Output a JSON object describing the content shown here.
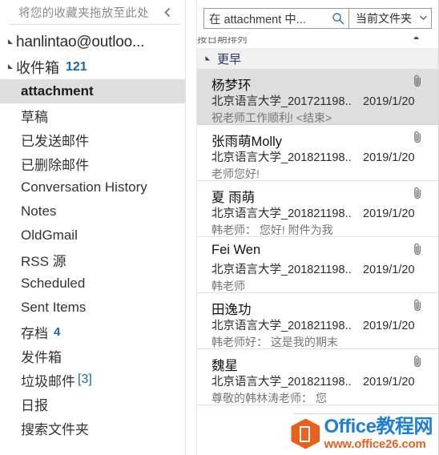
{
  "nav": {
    "favorites_hint": "将您的收藏夹拖放至此处",
    "collapse_icon": "chevron-left-icon",
    "account": {
      "label": "hanlintao@outloo...",
      "expander": "▲"
    },
    "inbox": {
      "label": "收件箱",
      "count": "121",
      "expander": "▲"
    },
    "items": [
      {
        "label": "attachment",
        "selected": true,
        "badge": ""
      },
      {
        "label": "草稿",
        "selected": false,
        "badge": ""
      },
      {
        "label": "已发送邮件",
        "selected": false,
        "badge": ""
      },
      {
        "label": "已删除邮件",
        "selected": false,
        "badge": ""
      },
      {
        "label": "Conversation History",
        "selected": false,
        "badge": ""
      },
      {
        "label": "Notes",
        "selected": false,
        "badge": ""
      },
      {
        "label": "OldGmail",
        "selected": false,
        "badge": ""
      },
      {
        "label": "RSS 源",
        "selected": false,
        "badge": ""
      },
      {
        "label": "Scheduled",
        "selected": false,
        "badge": ""
      },
      {
        "label": "Sent Items",
        "selected": false,
        "badge": ""
      },
      {
        "label": "存档",
        "selected": false,
        "badge": "4",
        "badge_style": "plain"
      },
      {
        "label": "发件箱",
        "selected": false,
        "badge": ""
      },
      {
        "label": "垃圾邮件",
        "selected": false,
        "badge": "[3]",
        "badge_style": "bracket"
      },
      {
        "label": "日报",
        "selected": false,
        "badge": ""
      },
      {
        "label": "搜索文件夹",
        "selected": false,
        "badge": ""
      }
    ]
  },
  "search": {
    "placeholder": "在 attachment 中...",
    "icon": "search-icon",
    "scope_label": "当前文件夹",
    "scope_caret": "▼"
  },
  "list_header": {
    "columns": "按日期排列",
    "sort_arrow": "▲"
  },
  "group": {
    "expander": "◢",
    "label": "更早"
  },
  "messages": [
    {
      "sender": "杨梦环",
      "subject": "北京语言大学_201721198...",
      "date": "2019/1/20",
      "preview": "祝老师工作顺利! <结束>",
      "attachment": "paperclip-icon",
      "selected": true
    },
    {
      "sender": "张雨萌Molly",
      "subject": "北京语言大学_201821198...",
      "date": "2019/1/20",
      "preview": "老师您好!",
      "attachment": "paperclip-icon",
      "selected": false
    },
    {
      "sender": "夏 雨萌",
      "subject": "北京语言大学_201821198...",
      "date": "2019/1/20",
      "preview": "韩老师：  您好!  附件为我",
      "attachment": "paperclip-icon",
      "selected": false
    },
    {
      "sender": "Fei Wen",
      "subject": "北京语言大学_201821198...",
      "date": "2019/1/20",
      "preview": "韩老师",
      "attachment": "paperclip-icon",
      "selected": false
    },
    {
      "sender": "田逸功",
      "subject": "北京语言大学_201821198...",
      "date": "2019/1/20",
      "preview": "韩老师好：  这是我的期末",
      "attachment": "paperclip-icon",
      "selected": false
    },
    {
      "sender": "魏星",
      "subject": "北京语言大学_201821198...",
      "date": "2019/1/20",
      "preview": "尊敬的韩林涛老师：  您",
      "attachment": "paperclip-icon",
      "selected": false
    }
  ],
  "watermark": {
    "title": "Office教程网",
    "url": "www.office26.com",
    "logo": "office-logo-icon"
  },
  "colors": {
    "accent_blue": "#1567b5",
    "group_text": "#1f3864",
    "selection_gray": "#dedede",
    "watermark_blue": "#1e7fd4",
    "watermark_orange": "#e8601c"
  }
}
